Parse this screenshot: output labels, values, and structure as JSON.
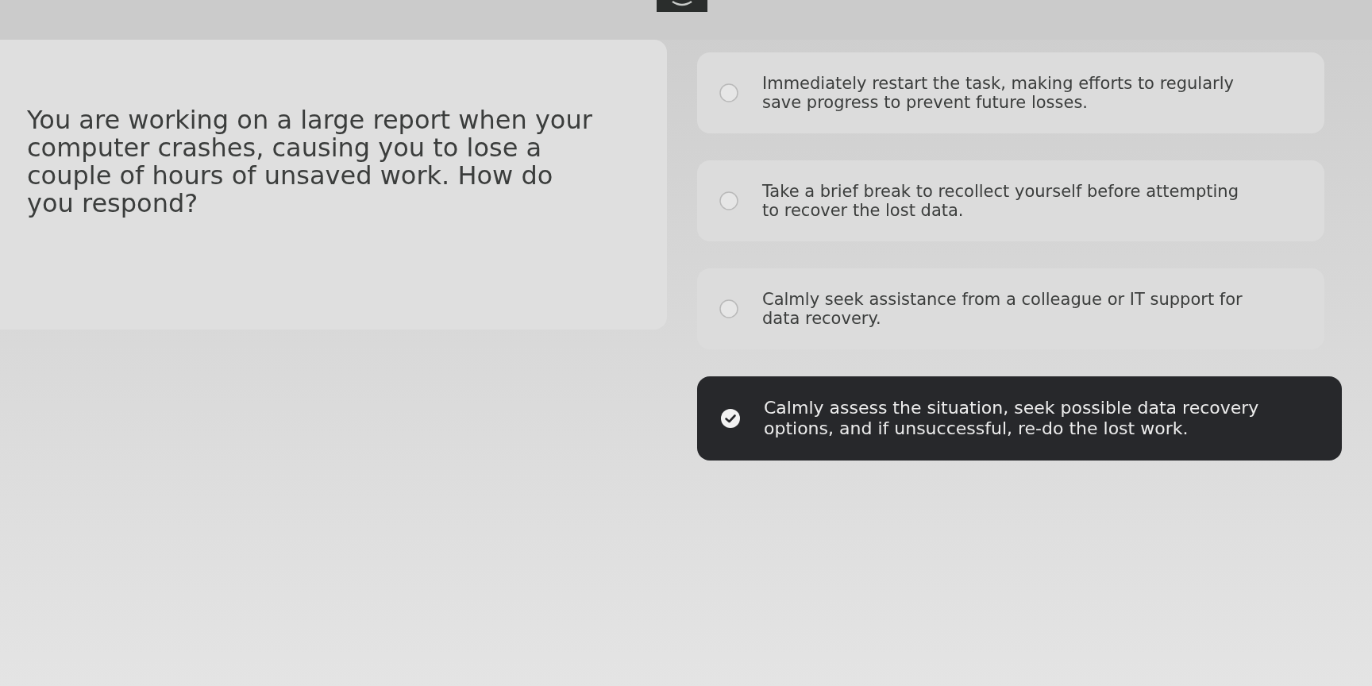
{
  "question": {
    "text": "You are working on a large report when your computer crashes, causing you to lose a couple of hours of unsaved work. How do you respond?"
  },
  "options": [
    {
      "text": "Immediately restart the task, making efforts to regularly save progress to prevent future losses.",
      "selected": false
    },
    {
      "text": "Take a brief break to recollect yourself before attempting to recover the lost data.",
      "selected": false
    },
    {
      "text": "Calmly seek assistance from a colleague or IT support for data recovery.",
      "selected": false
    },
    {
      "text": "Calmly assess the situation, seek possible data recovery options, and if unsuccessful, re-do the lost work.",
      "selected": true
    }
  ]
}
